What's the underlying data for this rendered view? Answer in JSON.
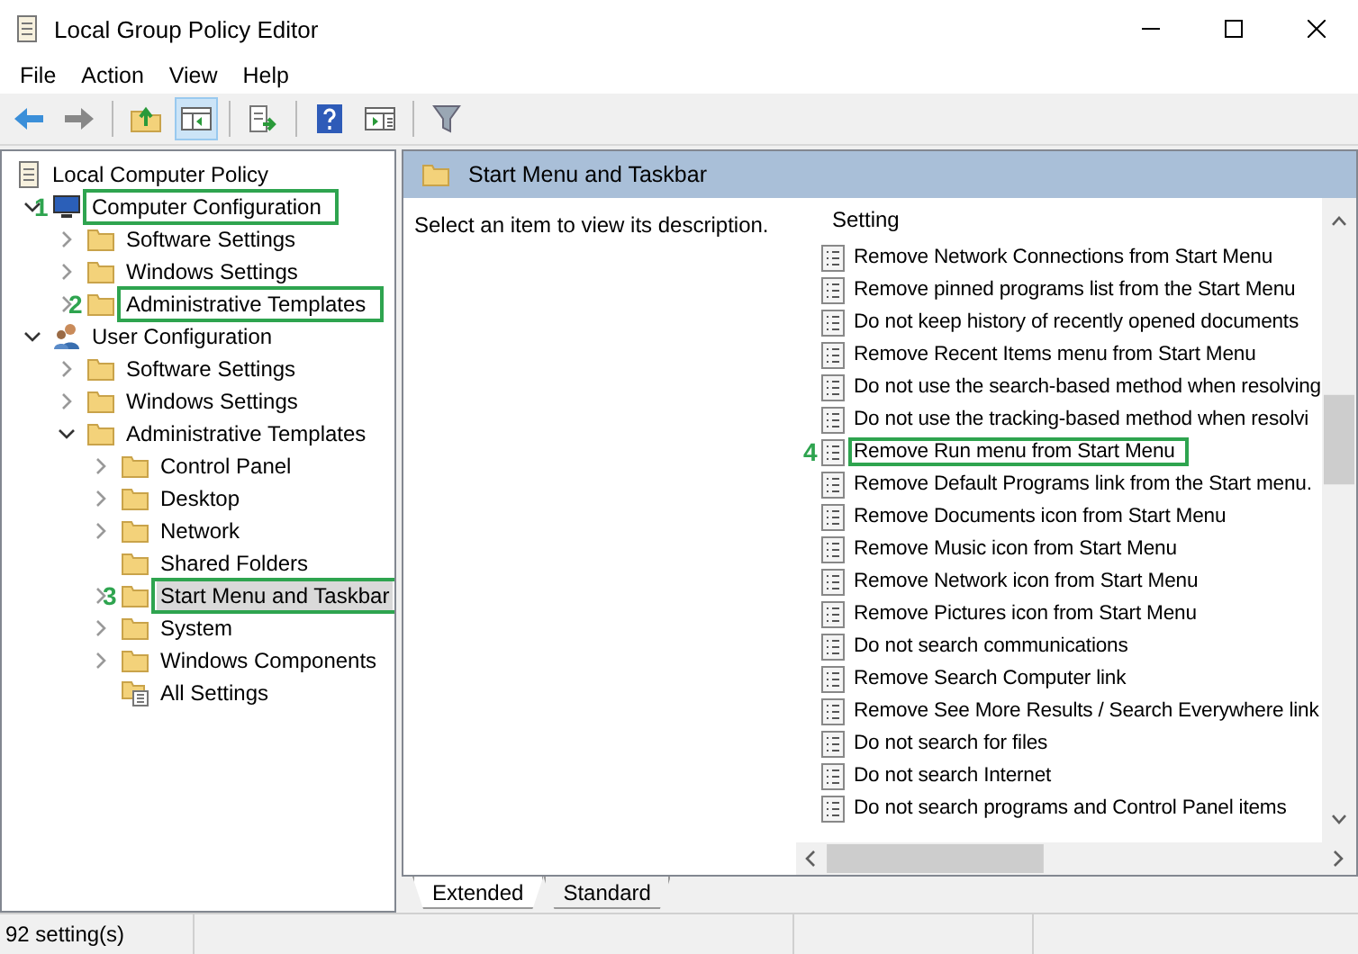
{
  "window": {
    "title": "Local Group Policy Editor"
  },
  "menu": [
    "File",
    "Action",
    "View",
    "Help"
  ],
  "tree": {
    "label": "Local Computer Policy",
    "kind": "policy",
    "selected": false,
    "children": [
      {
        "label": "Computer Configuration",
        "kind": "computer",
        "expanded": true,
        "selected": false,
        "callout": "1",
        "children": [
          {
            "label": "Software Settings",
            "kind": "folder",
            "expanded": false,
            "selected": false
          },
          {
            "label": "Windows Settings",
            "kind": "folder",
            "expanded": false,
            "selected": false
          },
          {
            "label": "Administrative Templates",
            "kind": "folder",
            "expanded": false,
            "selected": false,
            "callout": "2"
          }
        ]
      },
      {
        "label": "User Configuration",
        "kind": "users",
        "expanded": true,
        "selected": false,
        "children": [
          {
            "label": "Software Settings",
            "kind": "folder",
            "expanded": false,
            "selected": false
          },
          {
            "label": "Windows Settings",
            "kind": "folder",
            "expanded": false,
            "selected": false
          },
          {
            "label": "Administrative Templates",
            "kind": "folder",
            "expanded": true,
            "selected": false,
            "children": [
              {
                "label": "Control Panel",
                "kind": "folder",
                "expanded": false,
                "selected": false
              },
              {
                "label": "Desktop",
                "kind": "folder",
                "expanded": false,
                "selected": false
              },
              {
                "label": "Network",
                "kind": "folder",
                "expanded": false,
                "selected": false
              },
              {
                "label": "Shared Folders",
                "kind": "folder",
                "selected": false
              },
              {
                "label": "Start Menu and Taskbar",
                "kind": "folder",
                "expanded": false,
                "selected": true,
                "callout": "3"
              },
              {
                "label": "System",
                "kind": "folder",
                "expanded": false,
                "selected": false
              },
              {
                "label": "Windows Components",
                "kind": "folder",
                "expanded": false,
                "selected": false
              },
              {
                "label": "All Settings",
                "kind": "all-settings",
                "selected": false
              }
            ]
          }
        ]
      }
    ]
  },
  "details": {
    "title": "Start Menu and Taskbar",
    "description": "Select an item to view its description.",
    "column": "Setting",
    "settings": [
      {
        "name": "Remove Network Connections from Start Menu"
      },
      {
        "name": "Remove pinned programs list from the Start Menu"
      },
      {
        "name": "Do not keep history of recently opened documents"
      },
      {
        "name": "Remove Recent Items menu from Start Menu"
      },
      {
        "name": "Do not use the search-based method when resolving"
      },
      {
        "name": "Do not use the tracking-based method when resolvi"
      },
      {
        "name": "Remove Run menu from Start Menu",
        "callout": "4"
      },
      {
        "name": "Remove Default Programs link from the Start menu."
      },
      {
        "name": "Remove Documents icon from Start Menu"
      },
      {
        "name": "Remove Music icon from Start Menu"
      },
      {
        "name": "Remove Network icon from Start Menu"
      },
      {
        "name": "Remove Pictures icon from Start Menu"
      },
      {
        "name": "Do not search communications"
      },
      {
        "name": "Remove Search Computer link"
      },
      {
        "name": "Remove See More Results / Search Everywhere link"
      },
      {
        "name": "Do not search for files"
      },
      {
        "name": "Do not search Internet"
      },
      {
        "name": "Do not search programs and Control Panel items"
      }
    ],
    "tabs": [
      {
        "label": "Extended",
        "selected": true
      },
      {
        "label": "Standard",
        "selected": false
      }
    ]
  },
  "status_bar": "92 setting(s)"
}
